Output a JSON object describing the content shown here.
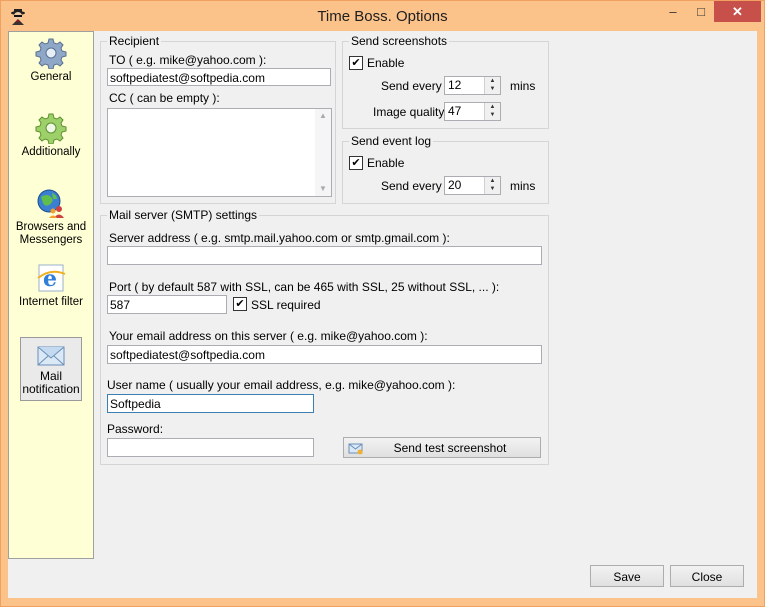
{
  "window": {
    "title": "Time Boss. Options"
  },
  "sidebar": {
    "items": [
      {
        "label": "General",
        "icon": "gear-icon"
      },
      {
        "label": "Additionally",
        "icon": "green-gear-icon"
      },
      {
        "label": "Browsers and Messengers",
        "icon": "globe-people-icon"
      },
      {
        "label": "Internet filter",
        "icon": "internet-explorer-icon"
      },
      {
        "label": "Mail notification",
        "icon": "envelope-icon"
      }
    ],
    "selected": "Mail notification"
  },
  "recipient": {
    "title": "Recipient",
    "to_label": "TO ( e.g. mike@yahoo.com ):",
    "to_value": "softpediatest@softpedia.com",
    "cc_label": "CC ( can be empty ):",
    "cc_value": ""
  },
  "screenshots": {
    "title": "Send screenshots",
    "enable_label": "Enable",
    "enabled": true,
    "send_every_label": "Send every",
    "send_every_value": "12",
    "mins_label": "mins",
    "quality_label": "Image quality",
    "quality_value": "47"
  },
  "eventlog": {
    "title": "Send event log",
    "enable_label": "Enable",
    "enabled": true,
    "send_every_label": "Send every",
    "send_every_value": "20",
    "mins_label": "mins"
  },
  "smtp": {
    "title": "Mail server (SMTP) settings",
    "server_label": "Server address   ( e.g. smtp.mail.yahoo.com or smtp.gmail.com ):",
    "server_value": "",
    "port_label": "Port   ( by default 587 with SSL, can be 465 with SSL, 25 without SSL, ... ):",
    "port_value": "587",
    "ssl_label": "SSL required",
    "ssl_checked": true,
    "email_label": "Your email address on this server ( e.g. mike@yahoo.com ):",
    "email_value": "softpediatest@softpedia.com",
    "user_label": "User name  ( usually your email address, e.g. mike@yahoo.com ):",
    "user_value": "Softpedia",
    "password_label": "Password:",
    "password_value": "",
    "test_button": "Send test screenshot"
  },
  "footer": {
    "save": "Save",
    "close": "Close"
  },
  "colors": {
    "frame": "#fbc38a",
    "sidebar": "#ffffd5",
    "close": "#c7504b"
  }
}
